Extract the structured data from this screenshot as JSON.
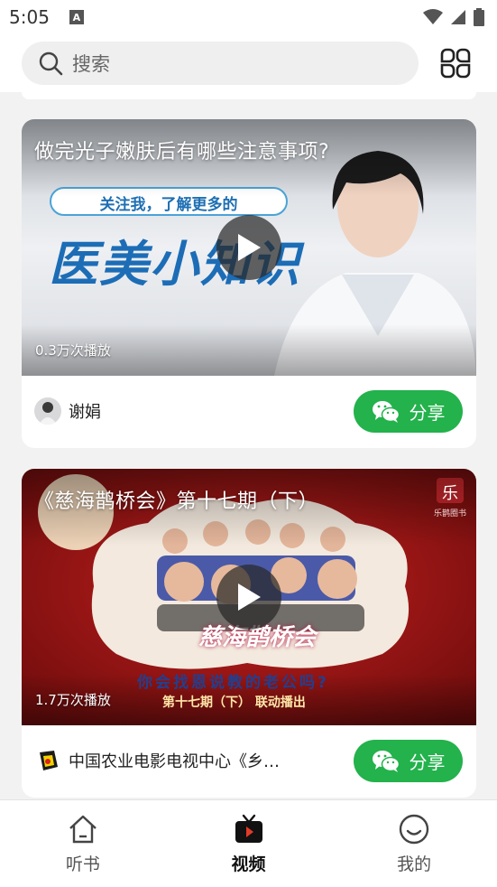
{
  "status_bar": {
    "time": "5:05",
    "notification_icon": "A"
  },
  "search": {
    "placeholder": "搜索"
  },
  "videos": [
    {
      "title": "做完光子嫩肤后有哪些注意事项?",
      "plays": "0.3万次播放",
      "author": "谢娟",
      "share_label": "分享",
      "thumb_banner": "关注我，了解更多的",
      "thumb_headline": "医美小知识"
    },
    {
      "title": "《慈海鹊桥会》第十七期（下）",
      "plays": "1.7万次播放",
      "author": "中国农业电影电视中心《乡约...",
      "share_label": "分享",
      "thumb_logo": "乐",
      "thumb_logo_text": "乐鹊圈书",
      "thumb_show": "慈海鹊桥会",
      "thumb_question": "你会找恩说教的老公吗?",
      "thumb_episode": "第十七期（下）  联动播出"
    }
  ],
  "nav": [
    {
      "label": "听书",
      "icon": "home-icon",
      "active": false
    },
    {
      "label": "视频",
      "icon": "tv-icon",
      "active": true
    },
    {
      "label": "我的",
      "icon": "smile-icon",
      "active": false
    }
  ],
  "colors": {
    "share_green": "#23b24c",
    "background": "#f2f2f2"
  }
}
